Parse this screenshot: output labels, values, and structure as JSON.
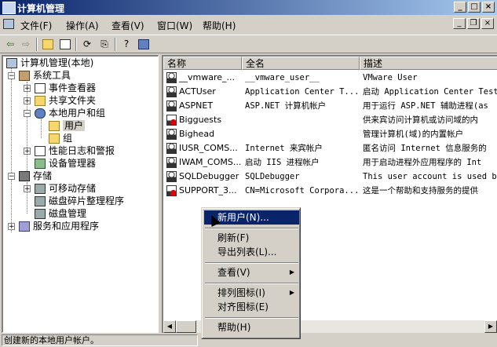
{
  "window": {
    "title": "计算机管理"
  },
  "menu": [
    "文件(F)",
    "操作(A)",
    "查看(V)",
    "窗口(W)",
    "帮助(H)"
  ],
  "tree": {
    "root": "计算机管理(本地)",
    "system_tools": "系统工具",
    "event_viewer": "事件查看器",
    "shared_folders": "共享文件夹",
    "local_users": "本地用户和组",
    "users": "用户",
    "groups": "组",
    "perf_logs": "性能日志和警报",
    "device_manager": "设备管理器",
    "storage": "存储",
    "removable": "可移动存储",
    "defrag": "磁盘碎片整理程序",
    "disk_mgmt": "磁盘管理",
    "services": "服务和应用程序"
  },
  "list": {
    "headers": [
      "名称",
      "全名",
      "描述"
    ],
    "rows": [
      {
        "name": "__vmware_...",
        "full": "__vmware_user__",
        "desc": "VMware User",
        "disabled": false
      },
      {
        "name": "ACTUser",
        "full": "Application Center T...",
        "desc": "启动 Application Center Test",
        "disabled": false
      },
      {
        "name": "ASPNET",
        "full": "ASP.NET 计算机帐户",
        "desc": "用于运行 ASP.NET 辅助进程(as",
        "disabled": false
      },
      {
        "name": "Bigguests",
        "full": "",
        "desc": "供来宾访问计算机或访问域的内",
        "disabled": true
      },
      {
        "name": "Bighead",
        "full": "",
        "desc": "管理计算机(域)的内置帐户",
        "disabled": false
      },
      {
        "name": "IUSR_COMS...",
        "full": "Internet 来宾帐户",
        "desc": "匿名访问 Internet 信息服务的",
        "disabled": false
      },
      {
        "name": "IWAM_COMS...",
        "full": "启动 IIS 进程帐户",
        "desc": "用于启动进程外应用程序的 Int",
        "disabled": false
      },
      {
        "name": "SQLDebugger",
        "full": "SQLDebugger",
        "desc": "This user account is used by",
        "disabled": false
      },
      {
        "name": "SUPPORT_3...",
        "full": "CN=Microsoft Corpora...",
        "desc": "这是一个帮助和支持服务的提供",
        "disabled": true
      }
    ]
  },
  "context_menu": {
    "new_user": "新用户(N)...",
    "refresh": "刷新(F)",
    "export": "导出列表(L)...",
    "view": "查看(V)",
    "arrange": "排列图标(I)",
    "line_up": "对齐图标(E)",
    "help": "帮助(H)"
  },
  "status": "创建新的本地用户帐户。"
}
